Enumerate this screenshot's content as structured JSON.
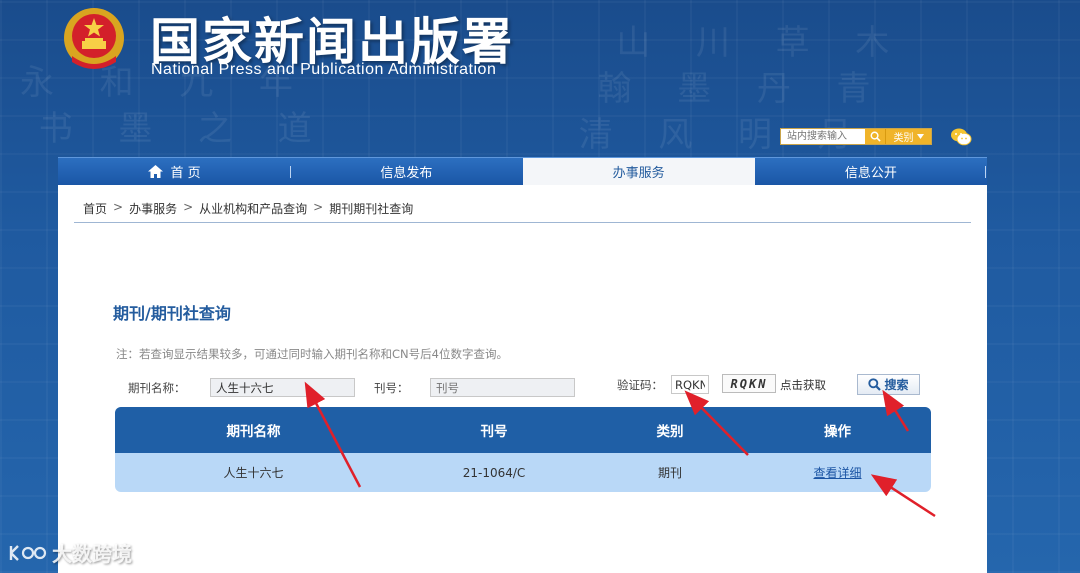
{
  "header": {
    "title_cn": "国家新闻出版署",
    "title_en": "National  Press and Publication Administration"
  },
  "site_search": {
    "placeholder": "站内搜索输入",
    "category_label": "类别"
  },
  "nav": {
    "items": [
      {
        "label": "首 页"
      },
      {
        "label": "信息发布"
      },
      {
        "label": "办事服务"
      },
      {
        "label": "信息公开"
      }
    ]
  },
  "breadcrumb": {
    "items": [
      "首页",
      "办事服务",
      "从业机构和产品查询",
      "期刊期刊社查询"
    ],
    "separator": ">"
  },
  "page": {
    "title": "期刊/期刊社查询",
    "note": "注：若查询显示结果较多，可通过同时输入期刊名称和CN号后4位数字查询。"
  },
  "form": {
    "name_label": "期刊名称：",
    "name_value": "人生十六七",
    "issue_label": "刊号：",
    "issue_placeholder": "刊号",
    "captcha_label": "验证码：",
    "captcha_value": "RQKN",
    "captcha_image_text": "RQKN",
    "captcha_hint": "点击获取",
    "search_button": "搜索"
  },
  "results": {
    "headers": [
      "期刊名称",
      "刊号",
      "类别",
      "操作"
    ],
    "rows": [
      {
        "name": "人生十六七",
        "issue": "21-1064/C",
        "category": "期刊",
        "action": "查看详细"
      }
    ]
  },
  "watermark": {
    "text": "大数跨境"
  },
  "colors": {
    "nav_blue": "#1a56a6",
    "table_header": "#1f5fa6",
    "table_row": "#b9d8f7",
    "accent_gold": "#f0b42a",
    "annotation_red": "#e0202a"
  }
}
